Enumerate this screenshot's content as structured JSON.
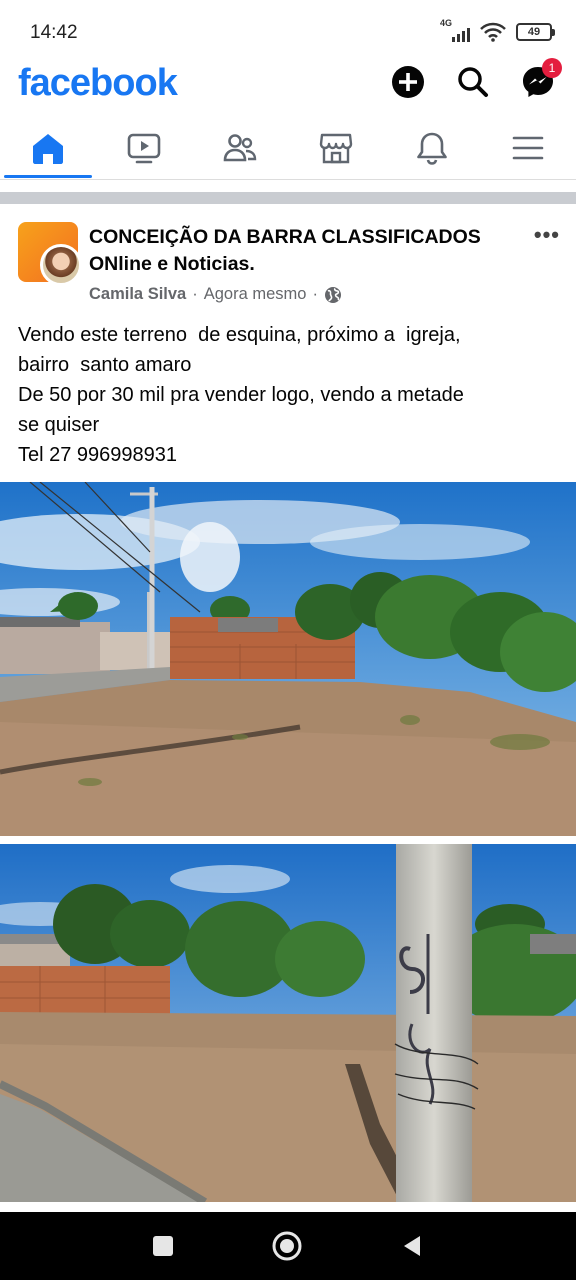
{
  "status_bar": {
    "time": "14:42",
    "network": "4G",
    "battery": "49"
  },
  "header": {
    "logo": "facebook",
    "messenger_badge": "1",
    "icons": [
      "plus-icon",
      "search-icon",
      "messenger-icon"
    ]
  },
  "nav_tabs": [
    {
      "name": "home-icon",
      "active": true
    },
    {
      "name": "video-icon",
      "active": false
    },
    {
      "name": "friends-icon",
      "active": false
    },
    {
      "name": "marketplace-icon",
      "active": false
    },
    {
      "name": "bell-icon",
      "active": false
    },
    {
      "name": "menu-icon",
      "active": false
    }
  ],
  "post": {
    "page_name": "CONCEIÇÃO DA BARRA CLASSIFICADOS ONline e Noticias.",
    "author": "Camila Silva",
    "separator": "·",
    "time": "Agora mesmo",
    "more": "•••",
    "text_lines": [
      "Vendo este terreno  de esquina, próximo a  igreja,",
      "bairro  santo amaro",
      "De 50 por 30 mil pra vender logo, vendo a metade",
      "se quiser",
      "Tel 27 996998931"
    ],
    "photos": [
      "photo-corner-lot",
      "photo-lot-with-pole"
    ],
    "pole_graffiti": "B$A"
  },
  "colors": {
    "brand": "#1877f2",
    "badge": "#e41e3f",
    "divider": "#c9ccd1",
    "meta": "#65676b"
  }
}
